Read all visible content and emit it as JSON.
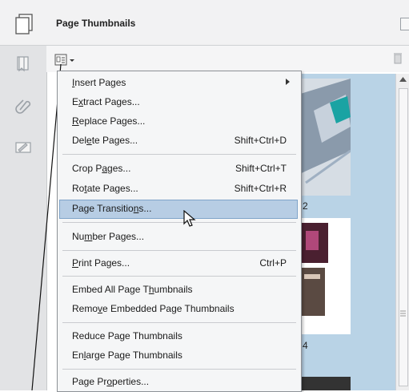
{
  "header": {
    "title": "Page Thumbnails"
  },
  "navstrip": {
    "icons": [
      "bookmark-icon",
      "attachment-icon",
      "signature-icon"
    ]
  },
  "toolbar": {
    "options_icon": "thumbnail-options-icon",
    "trash_icon": "trash-icon"
  },
  "menu": {
    "items": [
      {
        "pre": "",
        "u": "I",
        "post": "nsert Pages",
        "shortcut": "",
        "submenu": true
      },
      {
        "pre": "E",
        "u": "x",
        "post": "tract Pages...",
        "shortcut": ""
      },
      {
        "pre": "",
        "u": "R",
        "post": "eplace Pages...",
        "shortcut": ""
      },
      {
        "pre": "Del",
        "u": "e",
        "post": "te Pages...",
        "shortcut": "Shift+Ctrl+D"
      },
      {
        "pre": "Crop P",
        "u": "a",
        "post": "ges...",
        "shortcut": "Shift+Ctrl+T"
      },
      {
        "pre": "Ro",
        "u": "t",
        "post": "ate Pages...",
        "shortcut": "Shift+Ctrl+R"
      },
      {
        "pre": "Page Transitio",
        "u": "n",
        "post": "s...",
        "shortcut": ""
      },
      {
        "pre": "Nu",
        "u": "m",
        "post": "ber Pages...",
        "shortcut": ""
      },
      {
        "pre": "",
        "u": "P",
        "post": "rint Pages...",
        "shortcut": "Ctrl+P"
      },
      {
        "pre": "Embed All Page T",
        "u": "h",
        "post": "umbnails",
        "shortcut": ""
      },
      {
        "pre": "Remo",
        "u": "v",
        "post": "e Embedded Page Thumbnails",
        "shortcut": ""
      },
      {
        "pre": "Reduce Page Thumbnails",
        "u": "",
        "post": "",
        "shortcut": ""
      },
      {
        "pre": "En",
        "u": "l",
        "post": "arge Page Thumbnails",
        "shortcut": ""
      },
      {
        "pre": "Page Pr",
        "u": "o",
        "post": "perties...",
        "shortcut": ""
      }
    ]
  },
  "thumbnails": {
    "page_numbers": [
      "2",
      "4"
    ]
  },
  "colors": {
    "highlight": "#b7cde4",
    "thumb_bg": "#b9d3e6",
    "accent_teal": "#1aa3a3",
    "accent_dark": "#4a2030"
  }
}
